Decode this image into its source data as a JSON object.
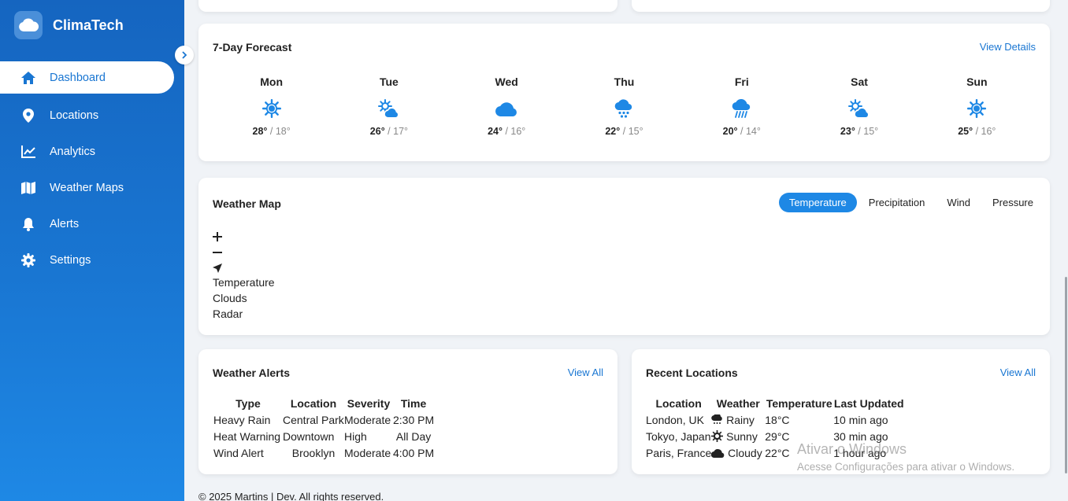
{
  "app": {
    "name": "ClimaTech",
    "accent": "#1976d2"
  },
  "sidebar": {
    "items": [
      {
        "label": "Dashboard",
        "icon": "home-icon"
      },
      {
        "label": "Locations",
        "icon": "map-pin-icon"
      },
      {
        "label": "Analytics",
        "icon": "chart-line-icon"
      },
      {
        "label": "Weather Maps",
        "icon": "map-icon"
      },
      {
        "label": "Alerts",
        "icon": "bell-icon"
      },
      {
        "label": "Settings",
        "icon": "gear-icon"
      }
    ]
  },
  "forecast": {
    "title": "7-Day Forecast",
    "link": "View Details",
    "days": [
      {
        "name": "Mon",
        "icon": "sun-icon",
        "hi": "28°",
        "lo": "18°"
      },
      {
        "name": "Tue",
        "icon": "cloud-sun-icon",
        "hi": "26°",
        "lo": "17°"
      },
      {
        "name": "Wed",
        "icon": "cloud-icon",
        "hi": "24°",
        "lo": "16°"
      },
      {
        "name": "Thu",
        "icon": "cloud-rain-icon",
        "hi": "22°",
        "lo": "15°"
      },
      {
        "name": "Fri",
        "icon": "cloud-showers-icon",
        "hi": "20°",
        "lo": "14°"
      },
      {
        "name": "Sat",
        "icon": "cloud-sun-icon",
        "hi": "23°",
        "lo": "15°"
      },
      {
        "name": "Sun",
        "icon": "sun-icon",
        "hi": "25°",
        "lo": "16°"
      }
    ]
  },
  "weather_map": {
    "title": "Weather Map",
    "tabs": [
      "Temperature",
      "Precipitation",
      "Wind",
      "Pressure"
    ],
    "active_tab": "Temperature",
    "controls": {
      "zoom_in": "+",
      "zoom_out": "−"
    },
    "layers": [
      "Temperature",
      "Clouds",
      "Radar"
    ]
  },
  "alerts": {
    "title": "Weather Alerts",
    "link": "View All",
    "columns": [
      "Type",
      "Location",
      "Severity",
      "Time"
    ],
    "rows": [
      [
        "Heavy Rain",
        "Central Park",
        "Moderate",
        "2:30 PM"
      ],
      [
        "Heat Warning",
        "Downtown",
        "High",
        "All Day"
      ],
      [
        "Wind Alert",
        "Brooklyn",
        "Moderate",
        "4:00 PM"
      ]
    ]
  },
  "recent": {
    "title": "Recent Locations",
    "link": "View All",
    "columns": [
      "Location",
      "Weather",
      "Temperature",
      "Last Updated"
    ],
    "rows": [
      {
        "location": "London, UK",
        "weather": "Rainy",
        "icon": "cloud-rain-icon",
        "temp": "18°C",
        "updated": "10 min ago"
      },
      {
        "location": "Tokyo, Japan",
        "weather": "Sunny",
        "icon": "sun-icon",
        "temp": "29°C",
        "updated": "30 min ago"
      },
      {
        "location": "Paris, France",
        "weather": "Cloudy",
        "icon": "cloud-icon",
        "temp": "22°C",
        "updated": "1 hour ago"
      }
    ]
  },
  "footer": {
    "text": "© 2025 Martins | Dev. All rights reserved."
  },
  "watermark": {
    "line1": "Ativar o Windows",
    "line2": "Acesse Configurações para ativar o Windows."
  }
}
